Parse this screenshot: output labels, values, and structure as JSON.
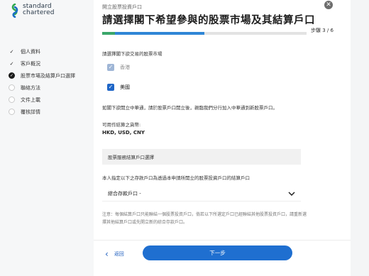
{
  "brand": {
    "line1": "standard",
    "line2": "chartered"
  },
  "sidebar": {
    "steps": [
      {
        "label": "個人資料",
        "state": "done"
      },
      {
        "label": "客戶概況",
        "state": "done"
      },
      {
        "label": "股票市場及結算戶口選擇",
        "state": "current"
      },
      {
        "label": "聯絡方法",
        "state": "todo"
      },
      {
        "label": "文件上載",
        "state": "todo"
      },
      {
        "label": "覆核詳情",
        "state": "todo"
      }
    ]
  },
  "header": {
    "subtitle": "開立股票投資戶口",
    "title": "請選擇閣下希望參與的股票市場及其結算戶口",
    "step_indicator": "步驟 3 / 6",
    "progress_fraction": 0.5
  },
  "form": {
    "market_prompt": "請選擇閣下欲交易的股票市場",
    "markets": [
      {
        "label": "香港",
        "checked": true,
        "disabled": true
      },
      {
        "label": "美國",
        "checked": true,
        "disabled": false
      }
    ],
    "northbound_note": "如閣下欲開立中華通，請於股票戶口開立後，親臨我們分行加入中華通到新股票戶口。",
    "currency_label": "可用作結算之貨幣:",
    "currencies": "HKD, USD, CNY",
    "settlement_section": "股票服務結算戶口選擇",
    "settlement_prompt": "本人指定以下之存款戶口為透過本申請所開立的股票投資戶口的結算戶口",
    "settlement_selected": "綜合存款戶口 -",
    "note": "注意：每個結算戶口只能聯結一個股票投資戶口，倘若以下所選定戶口已經聯結其他股票投資戶口，請重新選擇其他結算戶口或先開立新的綜合存款戶口。"
  },
  "footer": {
    "back_label": "返回",
    "next_label": "下一步"
  },
  "colors": {
    "primary": "#1f6fd0",
    "progress_green": "#3aa66a",
    "progress_blue": "#2f86d6"
  }
}
